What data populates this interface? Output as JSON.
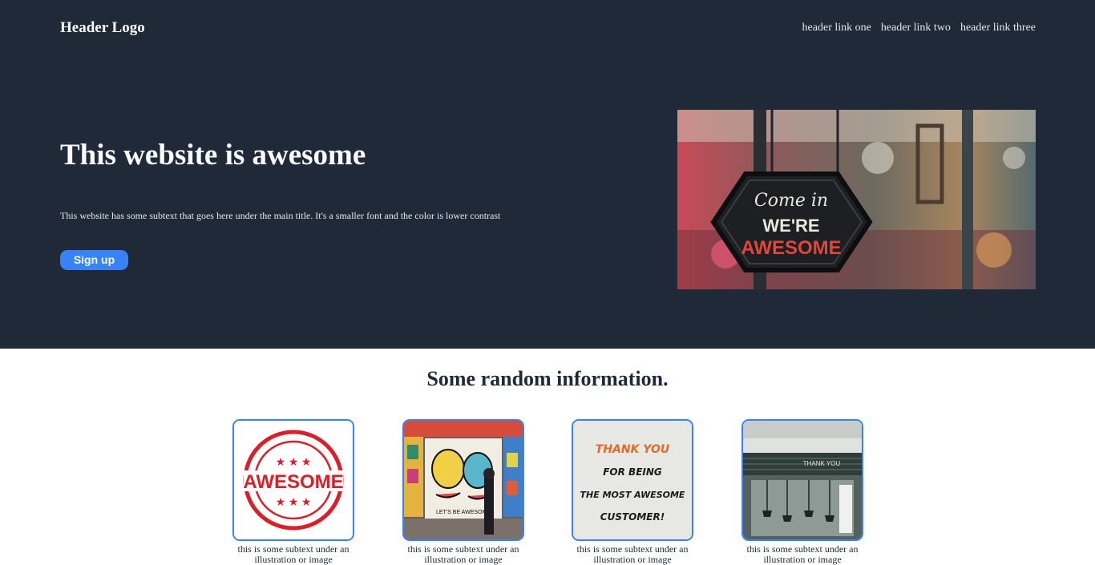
{
  "header": {
    "logo": "Header Logo",
    "links": [
      "header link one",
      "header link two",
      "header link three"
    ]
  },
  "hero": {
    "title": "This website is awesome",
    "subtitle": "This website has some subtext that goes here under the main title. It's a smaller font and the color is lower contrast",
    "button_label": "Sign up",
    "image": {
      "sign_script": "Come in",
      "sign_line1": "WE'RE",
      "sign_line2": "AWESOME"
    }
  },
  "info": {
    "title": "Some random information.",
    "cards": [
      {
        "caption": "this is some subtext under an illustration or image",
        "stamp_text": "AWESOME"
      },
      {
        "caption": "this is some subtext under an illustration or image",
        "mural_text": "LET'S BE AWESOME"
      },
      {
        "caption": "this is some subtext under an illustration or image",
        "note_lines": [
          "THANK YOU",
          "FOR BEING",
          "THE MOST AWESOME",
          "CUSTOMER!"
        ]
      },
      {
        "caption": "this is some subtext under an illustration or image",
        "shop_sign": "THANK YOU"
      }
    ]
  },
  "colors": {
    "hero_bg": "#1f2937",
    "accent": "#3882f6",
    "text_dark": "#1f2937",
    "text_light": "#f9fafb"
  }
}
